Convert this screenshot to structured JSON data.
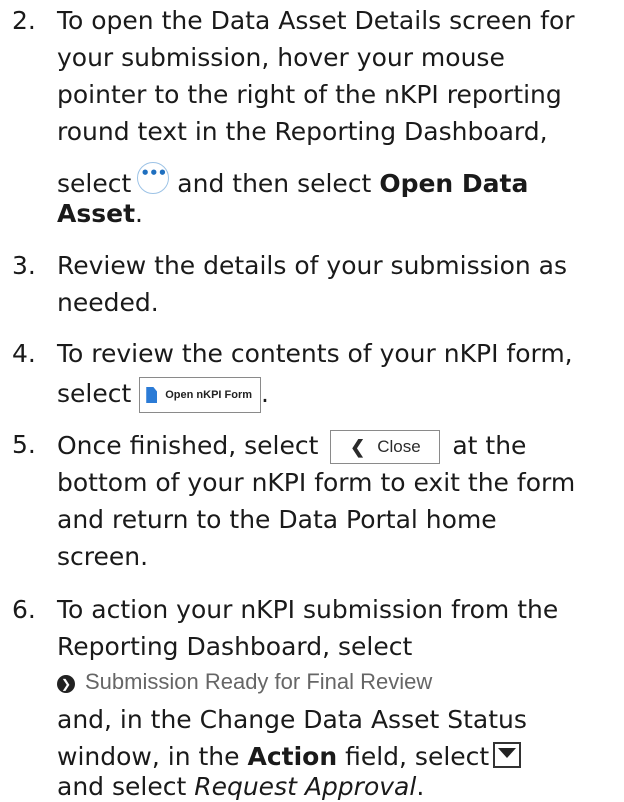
{
  "steps": [
    {
      "number": "2.",
      "lines": [
        "To open the Data Asset Details screen for",
        "your submission, hover your mouse",
        "pointer to the right of the nKPI reporting",
        "round text in the Reporting Dashboard,"
      ],
      "select_text": "select",
      "dots_glyph": "•••",
      "after_dots": "and then select",
      "bold_action": "Open Data",
      "bold_action_2": "Asset",
      "end_punct": "."
    },
    {
      "number": "3.",
      "lines": [
        "Review the details of your submission as",
        "needed."
      ]
    },
    {
      "number": "4.",
      "lines": [
        "To review the contents of your nKPI form,"
      ],
      "select_text": "select",
      "button_label": "Open nKPI Form",
      "end_punct": "."
    },
    {
      "number": "5.",
      "prefix": "Once finished, select",
      "button_label": "Close",
      "suffix": "at the",
      "lines": [
        "bottom of your nKPI form to exit the form",
        "and return to the Data Portal home",
        "screen."
      ]
    },
    {
      "number": "6.",
      "lines": [
        "To action your nKPI submission from the",
        "Reporting Dashboard, select"
      ],
      "status_label": "Submission Ready for Final Review",
      "line_after_status": "and, in the Change Data Asset Status",
      "window_prefix": "window, in the",
      "bold_field": "Action",
      "field_suffix": "field, select",
      "final_prefix": "and select",
      "final_italic": "Request Approval",
      "end_punct": "."
    }
  ],
  "icons": {
    "dots": "more-options-icon",
    "doc": "document-icon",
    "close_chevron": "‹",
    "status": "arrow-circle-icon",
    "dropdown": "dropdown-arrow-icon"
  }
}
